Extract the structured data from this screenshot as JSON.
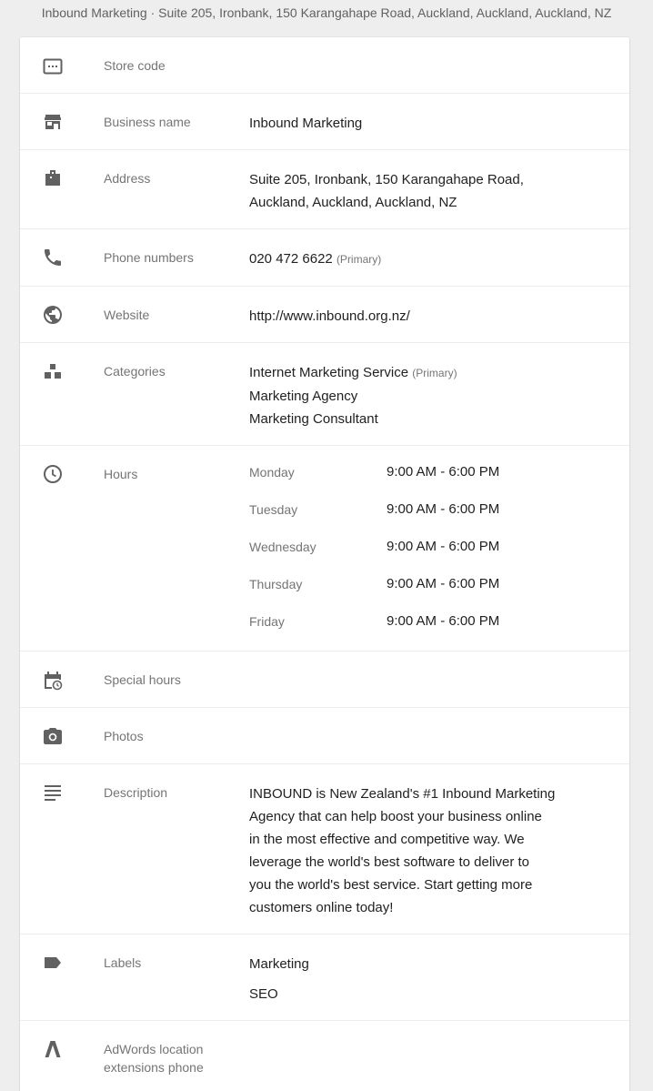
{
  "header": {
    "title": "Inbound Marketing · Suite 205, Ironbank, 150 Karangahape Road, Auckland, Auckland, Auckland, NZ"
  },
  "rows": {
    "store_code": {
      "label": "Store code",
      "icon": "store-code-icon"
    },
    "business_name": {
      "label": "Business name",
      "value": "Inbound Marketing",
      "icon": "storefront-icon"
    },
    "address": {
      "label": "Address",
      "lines": [
        "Suite 205, Ironbank, 150 Karangahape Road,",
        "Auckland, Auckland, Auckland, NZ"
      ],
      "icon": "address-icon"
    },
    "phone": {
      "label": "Phone numbers",
      "number": "020 472 6622",
      "tag": "(Primary)",
      "icon": "phone-icon"
    },
    "website": {
      "label": "Website",
      "value": "http://www.inbound.org.nz/",
      "icon": "globe-icon"
    },
    "categories": {
      "label": "Categories",
      "items": [
        {
          "name": "Internet Marketing Service",
          "tag": "(Primary)"
        },
        {
          "name": "Marketing Agency"
        },
        {
          "name": "Marketing Consultant"
        }
      ],
      "icon": "categories-icon"
    },
    "hours": {
      "label": "Hours",
      "days": [
        {
          "day": "Monday",
          "time": "9:00 AM - 6:00 PM"
        },
        {
          "day": "Tuesday",
          "time": "9:00 AM - 6:00 PM"
        },
        {
          "day": "Wednesday",
          "time": "9:00 AM - 6:00 PM"
        },
        {
          "day": "Thursday",
          "time": "9:00 AM - 6:00 PM"
        },
        {
          "day": "Friday",
          "time": "9:00 AM - 6:00 PM"
        }
      ],
      "icon": "clock-icon"
    },
    "special_hours": {
      "label": "Special hours",
      "icon": "calendar-clock-icon"
    },
    "photos": {
      "label": "Photos",
      "icon": "camera-icon"
    },
    "description": {
      "label": "Description",
      "lines": [
        "INBOUND is New Zealand's #1 Inbound Marketing",
        "Agency that can help boost your business online",
        "in the most effective and competitive way. We",
        "leverage the world's best software to deliver to",
        "you the world's best service. Start getting more",
        "customers online today!"
      ],
      "icon": "description-icon"
    },
    "labels": {
      "label": "Labels",
      "items": [
        "Marketing",
        "SEO"
      ],
      "icon": "label-icon"
    },
    "adwords": {
      "label_lines": [
        "AdWords location",
        "extensions phone"
      ],
      "icon": "adwords-icon"
    }
  },
  "colors": {
    "icon": "#616161",
    "label": "#757575",
    "text": "#212121",
    "divider": "#ececec",
    "background": "#eeeeee"
  }
}
